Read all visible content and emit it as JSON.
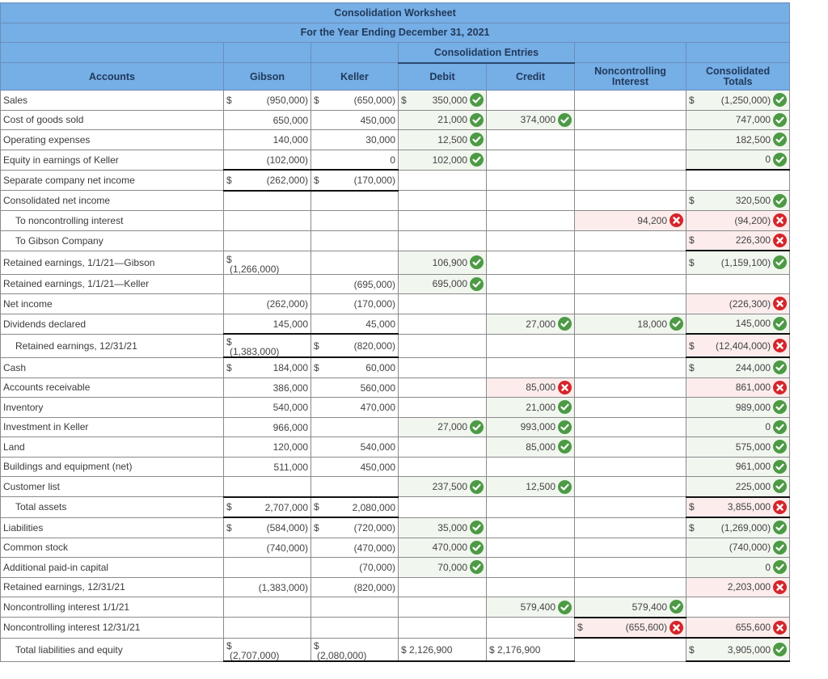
{
  "worksheet": {
    "title": "Consolidation Worksheet",
    "subtitle": "For the Year Ending December 31, 2021",
    "entries_group_label": "Consolidation Entries",
    "columns": {
      "accounts": "Accounts",
      "gibson": "Gibson",
      "keller": "Keller",
      "debit": "Debit",
      "credit": "Credit",
      "nci": "Noncontrolling Interest",
      "consolidated": "Consolidated Totals"
    },
    "status_icons": {
      "correct": "check-circle-icon",
      "incorrect": "x-circle-icon"
    },
    "colors": {
      "header_bg": "#76aee6",
      "correct": "#4d9a45",
      "incorrect": "#d4252b",
      "correct_bg": "#f1f6ef",
      "incorrect_bg": "#fcecec"
    },
    "rows": [
      {
        "account": "Sales",
        "gibson": "$ (950,000)",
        "keller": "$ (650,000)",
        "debit": {
          "value": "350,000",
          "dollar": true,
          "status": "correct"
        },
        "credit": null,
        "nci": null,
        "consolidated": {
          "value": "(1,250,000)",
          "dollar": true,
          "status": "correct"
        }
      },
      {
        "account": "Cost of goods sold",
        "gibson": "650,000",
        "keller": "450,000",
        "debit": {
          "value": "21,000",
          "status": "correct"
        },
        "credit": {
          "value": "374,000",
          "status": "correct"
        },
        "nci": null,
        "consolidated": {
          "value": "747,000",
          "status": "correct"
        }
      },
      {
        "account": "Operating expenses",
        "gibson": "140,000",
        "keller": "30,000",
        "debit": {
          "value": "12,500",
          "status": "correct"
        },
        "credit": null,
        "nci": null,
        "consolidated": {
          "value": "182,500",
          "status": "correct"
        }
      },
      {
        "account": "Equity in earnings of Keller",
        "gibson": "(102,000)",
        "keller": "0",
        "debit": {
          "value": "102,000",
          "status": "correct"
        },
        "credit": null,
        "nci": null,
        "consolidated": {
          "value": "0",
          "status": "correct"
        }
      },
      {
        "account": "Separate company net income",
        "gibson": "$ (262,000)",
        "keller": "$ (170,000)",
        "debit": null,
        "credit": null,
        "nci": null,
        "consolidated": null
      },
      {
        "account": "Consolidated net income",
        "gibson": "",
        "keller": "",
        "debit": null,
        "credit": null,
        "nci": null,
        "consolidated": {
          "value": "320,500",
          "dollar": true,
          "status": "correct"
        }
      },
      {
        "account": "To noncontrolling interest",
        "indent": true,
        "gibson": "",
        "keller": "",
        "debit": null,
        "credit": null,
        "nci": {
          "value": "94,200",
          "status": "incorrect"
        },
        "consolidated": {
          "value": "(94,200)",
          "status": "incorrect"
        }
      },
      {
        "account": "To Gibson Company",
        "indent": true,
        "gibson": "",
        "keller": "",
        "debit": null,
        "credit": null,
        "nci": null,
        "consolidated": {
          "value": "226,300",
          "dollar": true,
          "status": "incorrect"
        }
      },
      {
        "account": "Retained earnings, 1/1/21—Gibson",
        "gibson": "$ (1,266,000)",
        "gibson_stacked": true,
        "keller": "",
        "debit": {
          "value": "106,900",
          "status": "correct"
        },
        "credit": null,
        "nci": null,
        "consolidated": {
          "value": "(1,159,100)",
          "dollar": true,
          "status": "correct"
        }
      },
      {
        "account": "Retained earnings, 1/1/21—Keller",
        "gibson": "",
        "keller": "(695,000)",
        "debit": {
          "value": "695,000",
          "status": "correct"
        },
        "credit": null,
        "nci": null,
        "consolidated": null
      },
      {
        "account": "Net income",
        "gibson": "(262,000)",
        "keller": "(170,000)",
        "debit": null,
        "credit": null,
        "nci": null,
        "consolidated": {
          "value": "(226,300)",
          "status": "incorrect"
        }
      },
      {
        "account": "Dividends declared",
        "gibson": "145,000",
        "keller": "45,000",
        "debit": null,
        "credit": {
          "value": "27,000",
          "status": "correct"
        },
        "nci": {
          "value": "18,000",
          "status": "correct"
        },
        "consolidated": {
          "value": "145,000",
          "status": "correct"
        }
      },
      {
        "account": "Retained earnings, 12/31/21",
        "indent": true,
        "gibson": "$ (1,383,000)",
        "gibson_stacked": true,
        "keller": "$ (820,000)",
        "debit": null,
        "credit": null,
        "nci": null,
        "consolidated": {
          "value": "(12,404,000)",
          "dollar": true,
          "status": "incorrect"
        }
      },
      {
        "account": "Cash",
        "gibson": "$ 184,000",
        "keller": "$ 60,000",
        "debit": null,
        "credit": null,
        "nci": null,
        "consolidated": {
          "value": "244,000",
          "dollar": true,
          "status": "correct"
        }
      },
      {
        "account": "Accounts receivable",
        "gibson": "386,000",
        "keller": "560,000",
        "debit": null,
        "credit": {
          "value": "85,000",
          "status": "incorrect"
        },
        "nci": null,
        "consolidated": {
          "value": "861,000",
          "status": "incorrect"
        }
      },
      {
        "account": "Inventory",
        "gibson": "540,000",
        "keller": "470,000",
        "debit": null,
        "credit": {
          "value": "21,000",
          "status": "correct"
        },
        "nci": null,
        "consolidated": {
          "value": "989,000",
          "status": "correct"
        }
      },
      {
        "account": "Investment in Keller",
        "gibson": "966,000",
        "keller": "",
        "debit": {
          "value": "27,000",
          "status": "correct"
        },
        "credit": {
          "value": "993,000",
          "status": "correct"
        },
        "nci": null,
        "consolidated": {
          "value": "0",
          "status": "correct"
        }
      },
      {
        "account": "Land",
        "gibson": "120,000",
        "keller": "540,000",
        "debit": null,
        "credit": {
          "value": "85,000",
          "status": "correct"
        },
        "nci": null,
        "consolidated": {
          "value": "575,000",
          "status": "correct"
        }
      },
      {
        "account": "Buildings and equipment (net)",
        "gibson": "511,000",
        "keller": "450,000",
        "debit": null,
        "credit": null,
        "nci": null,
        "consolidated": {
          "value": "961,000",
          "status": "correct"
        }
      },
      {
        "account": "Customer list",
        "gibson": "",
        "keller": "",
        "debit": {
          "value": "237,500",
          "status": "correct"
        },
        "credit": {
          "value": "12,500",
          "status": "correct"
        },
        "nci": null,
        "consolidated": {
          "value": "225,000",
          "status": "correct"
        }
      },
      {
        "account": "Total assets",
        "indent": true,
        "gibson": "$ 2,707,000",
        "keller": "$ 2,080,000",
        "debit": null,
        "credit": null,
        "nci": null,
        "consolidated": {
          "value": "3,855,000",
          "dollar": true,
          "status": "incorrect"
        }
      },
      {
        "account": "Liabilities",
        "gibson": "$ (584,000)",
        "keller": "$ (720,000)",
        "debit": {
          "value": "35,000",
          "status": "correct"
        },
        "credit": null,
        "nci": null,
        "consolidated": {
          "value": "(1,269,000)",
          "dollar": true,
          "status": "correct"
        }
      },
      {
        "account": "Common stock",
        "gibson": "(740,000)",
        "keller": "(470,000)",
        "debit": {
          "value": "470,000",
          "status": "correct"
        },
        "credit": null,
        "nci": null,
        "consolidated": {
          "value": "(740,000)",
          "status": "correct"
        }
      },
      {
        "account": "Additional paid-in capital",
        "gibson": "",
        "keller": "(70,000)",
        "debit": {
          "value": "70,000",
          "status": "correct"
        },
        "credit": null,
        "nci": null,
        "consolidated": {
          "value": "0",
          "status": "correct"
        }
      },
      {
        "account": "Retained earnings, 12/31/21",
        "gibson": "(1,383,000)",
        "keller": "(820,000)",
        "debit": null,
        "credit": null,
        "nci": null,
        "consolidated": {
          "value": "2,203,000",
          "status": "incorrect"
        }
      },
      {
        "account": "Noncontrolling interest 1/1/21",
        "gibson": "",
        "keller": "",
        "debit": null,
        "credit": {
          "value": "579,400",
          "status": "correct"
        },
        "nci": {
          "value": "579,400",
          "status": "correct"
        },
        "consolidated": null
      },
      {
        "account": "Noncontrolling interest 12/31/21",
        "gibson": "",
        "keller": "",
        "debit": null,
        "credit": null,
        "nci": {
          "value": "(655,600)",
          "dollar": true,
          "status": "incorrect"
        },
        "consolidated": {
          "value": "655,600",
          "status": "incorrect"
        }
      },
      {
        "account": "Total liabilities and equity",
        "indent": true,
        "gibson": "$ (2,707,000)",
        "gibson_stacked": true,
        "keller": "$ (2,080,000)",
        "keller_stacked": true,
        "debit": {
          "value": "$ 2,126,900",
          "plain": true
        },
        "credit": {
          "value": "$ 2,176,900",
          "plain": true
        },
        "nci": null,
        "consolidated": {
          "value": "3,905,000",
          "dollar": true,
          "status": "correct"
        }
      }
    ]
  }
}
